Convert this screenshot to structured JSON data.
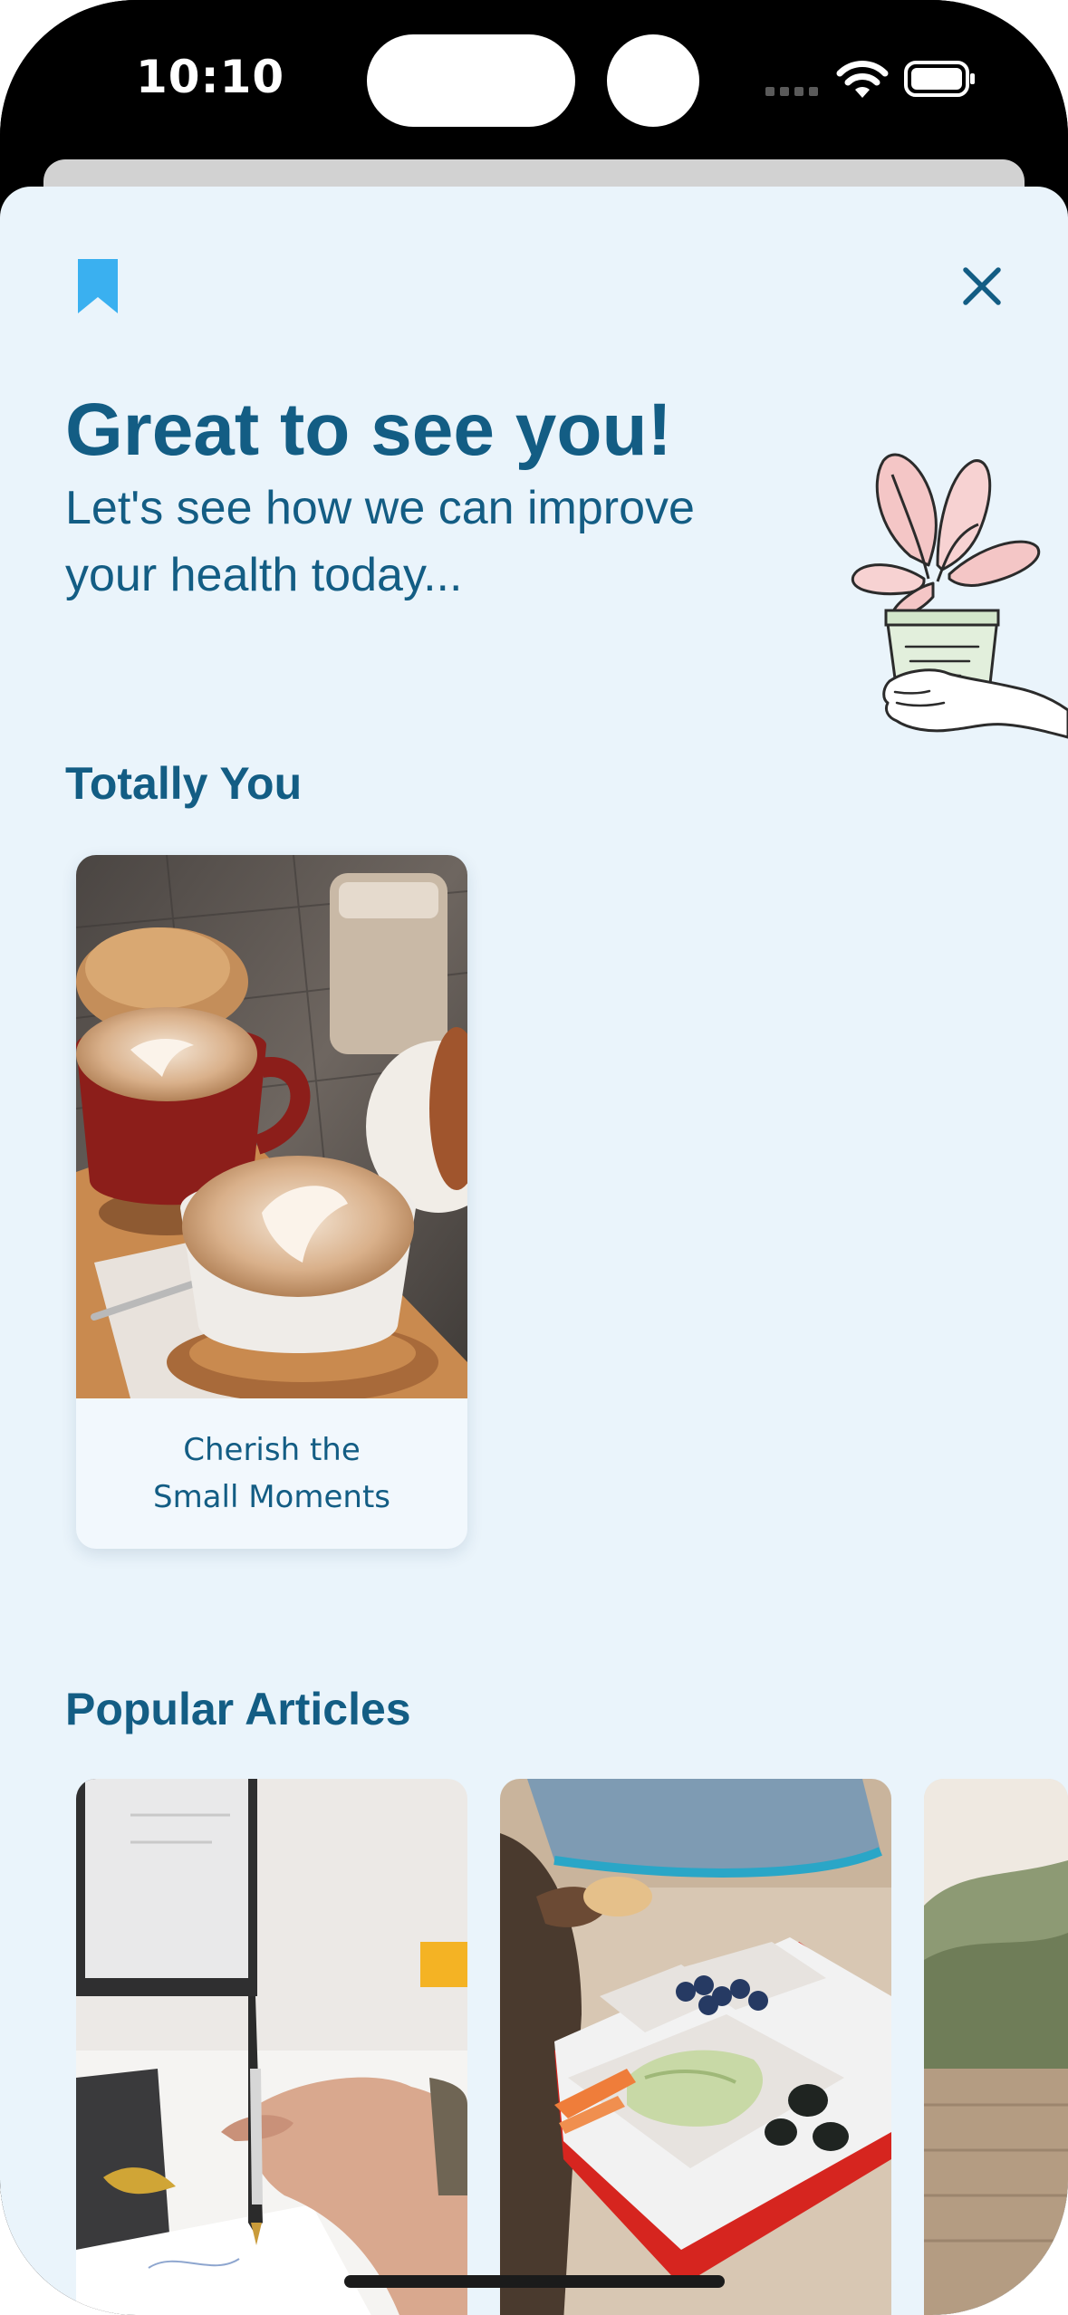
{
  "status_bar": {
    "time": "10:10"
  },
  "header": {
    "bookmark_icon": "bookmark-icon",
    "close_icon": "close-icon"
  },
  "hero": {
    "title": "Great to see you!",
    "subtitle": "Let's see how we can improve your health today..."
  },
  "sections": {
    "totally_you": {
      "title": "Totally You",
      "cards": [
        {
          "title": "Cherish the Small Moments"
        }
      ]
    },
    "popular_articles": {
      "title": "Popular Articles"
    }
  },
  "colors": {
    "background": "#eaf4fb",
    "primary_text": "#135d84",
    "accent": "#3ab0f0"
  }
}
